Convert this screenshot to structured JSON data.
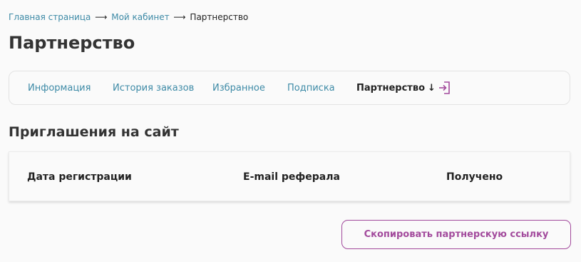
{
  "breadcrumb": {
    "items": [
      {
        "label": "Главная страница",
        "link": true
      },
      {
        "label": "Мой кабинет",
        "link": true
      },
      {
        "label": "Партнерство",
        "link": false
      }
    ],
    "separator": "⟶"
  },
  "page": {
    "title": "Партнерство"
  },
  "tabs": {
    "items": [
      {
        "label": "Информация",
        "active": false
      },
      {
        "label": "История заказов",
        "active": false
      },
      {
        "label": "Избранное",
        "active": false
      },
      {
        "label": "Подписка",
        "active": false
      },
      {
        "label": "Партнерство",
        "active": true,
        "arrow": "↓"
      }
    ],
    "logout_icon": "logout-icon"
  },
  "invitations": {
    "title": "Приглашения на сайт",
    "columns": [
      "Дата регистрации",
      "E-mail реферала",
      "Получено"
    ],
    "rows": []
  },
  "actions": {
    "copy_link_label": "Скопировать партнерскую ссылку"
  },
  "colors": {
    "link": "#3d8aa6",
    "accent": "#a24a9c",
    "text": "#222222",
    "background": "#fafafa"
  }
}
